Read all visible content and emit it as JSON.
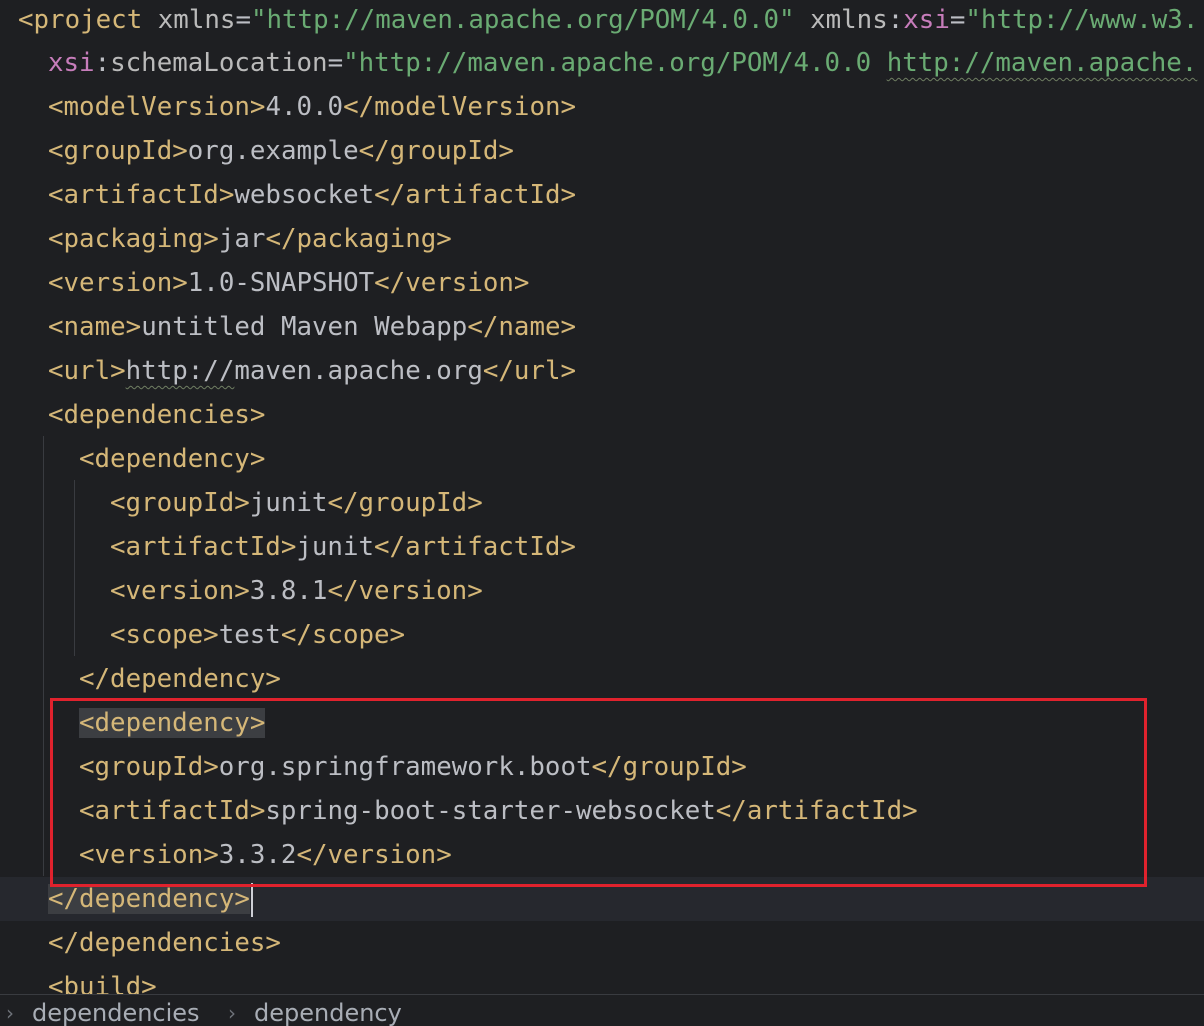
{
  "editor": {
    "lines": [
      {
        "segments": [
          {
            "t": "<project ",
            "c": "tag"
          },
          {
            "t": "xmlns",
            "c": "attr"
          },
          {
            "t": "=",
            "c": "txt"
          },
          {
            "t": "\"http://maven.apache.org/POM/4.0.0\"",
            "c": "str"
          },
          {
            "t": " ",
            "c": "txt"
          },
          {
            "t": "xmlns",
            "c": "attr"
          },
          {
            "t": ":",
            "c": "txt"
          },
          {
            "t": "xsi",
            "c": "ns"
          },
          {
            "t": "=",
            "c": "txt"
          },
          {
            "t": "\"http://www.w3.",
            "c": "str"
          }
        ]
      },
      {
        "segments": [
          {
            "t": "xsi",
            "c": "ns"
          },
          {
            "t": ":",
            "c": "txt"
          },
          {
            "t": "schemaLocation",
            "c": "attr"
          },
          {
            "t": "=",
            "c": "txt"
          },
          {
            "t": "\"http://maven.apache.org/POM/4.0.0 ",
            "c": "str"
          },
          {
            "t": "http://maven.apache.",
            "c": "str url"
          }
        ]
      },
      {
        "segments": [
          {
            "t": "<modelVersion>",
            "c": "tag"
          },
          {
            "t": "4.0.0",
            "c": "txt"
          },
          {
            "t": "</modelVersion>",
            "c": "tag"
          }
        ]
      },
      {
        "segments": [
          {
            "t": "<groupId>",
            "c": "tag"
          },
          {
            "t": "org.example",
            "c": "txt"
          },
          {
            "t": "</groupId>",
            "c": "tag"
          }
        ]
      },
      {
        "segments": [
          {
            "t": "<artifactId>",
            "c": "tag"
          },
          {
            "t": "websocket",
            "c": "txt"
          },
          {
            "t": "</artifactId>",
            "c": "tag"
          }
        ]
      },
      {
        "segments": [
          {
            "t": "<packaging>",
            "c": "tag"
          },
          {
            "t": "jar",
            "c": "txt"
          },
          {
            "t": "</packaging>",
            "c": "tag"
          }
        ]
      },
      {
        "segments": [
          {
            "t": "<version>",
            "c": "tag"
          },
          {
            "t": "1.0-SNAPSHOT",
            "c": "txt"
          },
          {
            "t": "</version>",
            "c": "tag"
          }
        ]
      },
      {
        "segments": [
          {
            "t": "<name>",
            "c": "tag"
          },
          {
            "t": "untitled Maven Webapp",
            "c": "txt"
          },
          {
            "t": "</name>",
            "c": "tag"
          }
        ]
      },
      {
        "segments": [
          {
            "t": "<url>",
            "c": "tag"
          },
          {
            "t": "http://",
            "c": "txt url"
          },
          {
            "t": "maven.apache.org",
            "c": "txt"
          },
          {
            "t": "</url>",
            "c": "tag"
          }
        ]
      },
      {
        "segments": [
          {
            "t": "<dependencies>",
            "c": "tag"
          }
        ]
      },
      {
        "segments": [
          {
            "t": "<dependency>",
            "c": "tag"
          }
        ]
      },
      {
        "segments": [
          {
            "t": "<groupId>",
            "c": "tag"
          },
          {
            "t": "junit",
            "c": "txt"
          },
          {
            "t": "</groupId>",
            "c": "tag"
          }
        ]
      },
      {
        "segments": [
          {
            "t": "<artifactId>",
            "c": "tag"
          },
          {
            "t": "junit",
            "c": "txt"
          },
          {
            "t": "</artifactId>",
            "c": "tag"
          }
        ]
      },
      {
        "segments": [
          {
            "t": "<version>",
            "c": "tag"
          },
          {
            "t": "3.8.1",
            "c": "txt"
          },
          {
            "t": "</version>",
            "c": "tag"
          }
        ]
      },
      {
        "segments": [
          {
            "t": "<scope>",
            "c": "tag"
          },
          {
            "t": "test",
            "c": "txt"
          },
          {
            "t": "</scope>",
            "c": "tag"
          }
        ]
      },
      {
        "segments": [
          {
            "t": "</dependency>",
            "c": "tag"
          }
        ]
      },
      {
        "segments": [
          {
            "t": "<dependency>",
            "c": "tag hl"
          }
        ]
      },
      {
        "segments": [
          {
            "t": "<groupId>",
            "c": "tag"
          },
          {
            "t": "org.springframework.boot",
            "c": "txt"
          },
          {
            "t": "</groupId>",
            "c": "tag"
          }
        ]
      },
      {
        "segments": [
          {
            "t": "<artifactId>",
            "c": "tag"
          },
          {
            "t": "spring-boot-starter-websocket",
            "c": "txt"
          },
          {
            "t": "</artifactId>",
            "c": "tag"
          }
        ]
      },
      {
        "segments": [
          {
            "t": "<version>",
            "c": "tag"
          },
          {
            "t": "3.3.2",
            "c": "txt"
          },
          {
            "t": "</version>",
            "c": "tag"
          }
        ]
      },
      {
        "segments": [
          {
            "t": "</dependency>",
            "c": "tag hl"
          }
        ]
      },
      {
        "segments": [
          {
            "t": "</dependencies>",
            "c": "tag"
          }
        ]
      },
      {
        "segments": [
          {
            "t": "<build>",
            "c": "tag"
          }
        ]
      }
    ]
  },
  "breadcrumb": {
    "items": [
      "dependencies",
      "dependency"
    ]
  },
  "colors": {
    "background": "#1e1f22",
    "tag": "#d5b778",
    "string": "#6aab73",
    "namespace": "#c77dbb",
    "text": "#bcbec4",
    "highlight_box": "#e0222d"
  }
}
